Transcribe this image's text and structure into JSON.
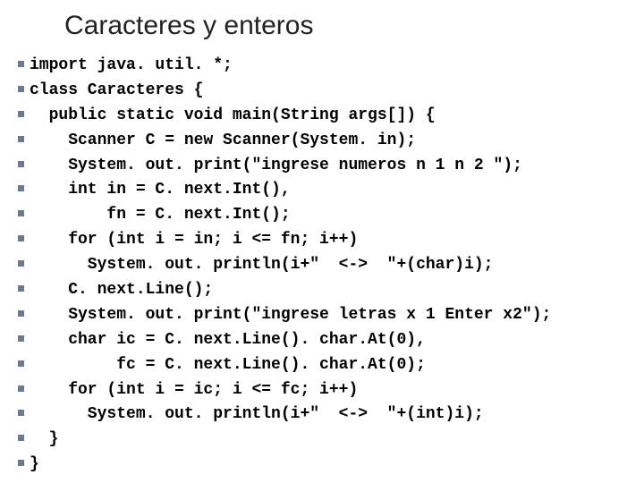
{
  "title": "Caracteres y enteros",
  "lines": [
    "import java. util. *;",
    "class Caracteres {",
    "  public static void main(String args[]) {",
    "    Scanner C = new Scanner(System. in);",
    "    System. out. print(\"ingrese numeros n 1 n 2 \");",
    "    int in = C. next.Int(),",
    "        fn = C. next.Int();",
    "    for (int i = in; i <= fn; i++)",
    "      System. out. println(i+\"  <->  \"+(char)i);",
    "    C. next.Line();",
    "    System. out. print(\"ingrese letras x 1 Enter x2\");",
    "    char ic = C. next.Line(). char.At(0),",
    "         fc = C. next.Line(). char.At(0);",
    "    for (int i = ic; i <= fc; i++)",
    "      System. out. println(i+\"  <->  \"+(int)i);",
    "  }",
    "}"
  ]
}
